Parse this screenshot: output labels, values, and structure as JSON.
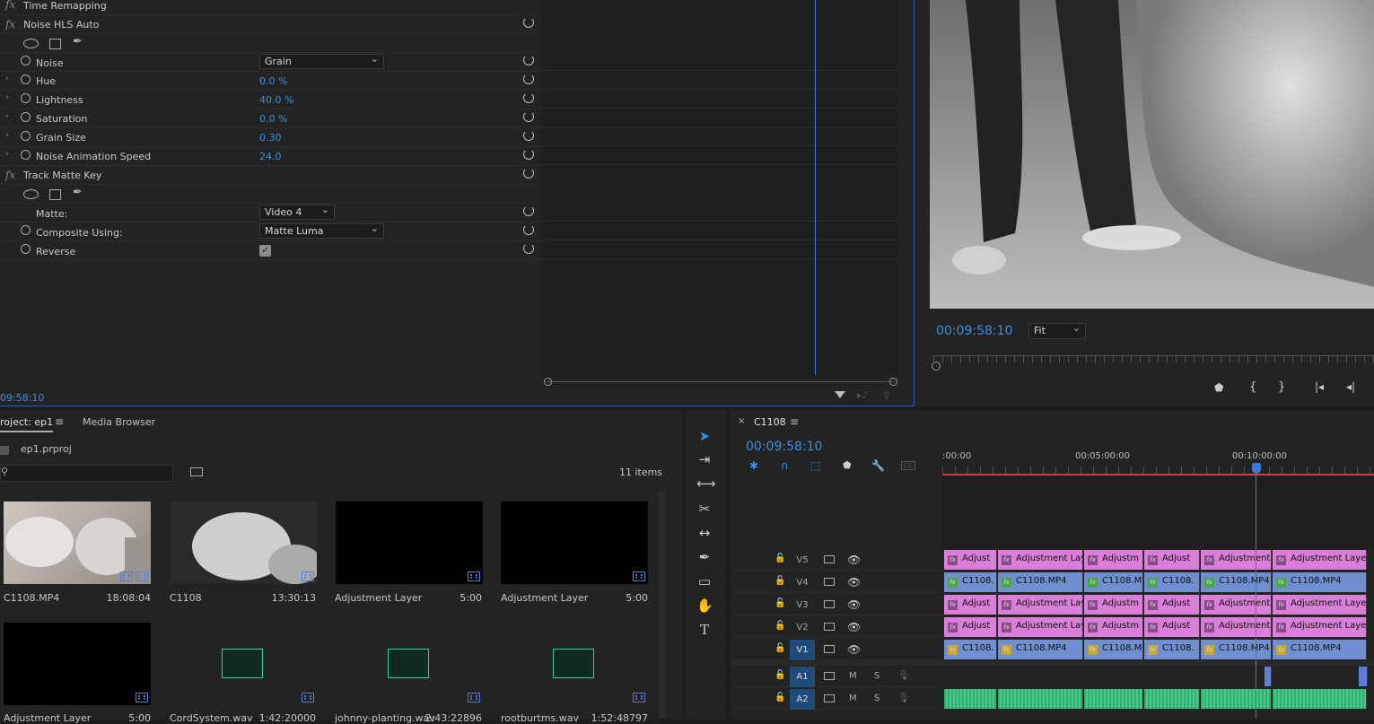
{
  "effect_controls": {
    "rows": [
      {
        "name": "Time Remapping",
        "type": "effect"
      },
      {
        "name": "Noise HLS Auto",
        "type": "effect"
      },
      {
        "type": "masks"
      },
      {
        "name": "Noise",
        "value": "Grain",
        "type": "dropdown"
      },
      {
        "name": "Hue",
        "value": "0.0 %",
        "type": "value"
      },
      {
        "name": "Lightness",
        "value": "40.0 %",
        "type": "value"
      },
      {
        "name": "Saturation",
        "value": "0.0 %",
        "type": "value"
      },
      {
        "name": "Grain Size",
        "value": "0.30",
        "type": "value"
      },
      {
        "name": "Noise Animation Speed",
        "value": "24.0",
        "type": "value"
      },
      {
        "name": "Track Matte Key",
        "type": "effect"
      },
      {
        "type": "masks"
      },
      {
        "name": "Matte:",
        "value": "Video 4",
        "type": "dropdown"
      },
      {
        "name": "Composite Using:",
        "value": "Matte Luma",
        "type": "dropdown"
      },
      {
        "name": "Reverse",
        "checked": true,
        "type": "checkbox"
      }
    ],
    "timecode": "09:58:10"
  },
  "program_monitor": {
    "timecode": "00:09:58:10",
    "fit": "Fit"
  },
  "project": {
    "tab_project": "roject: ep1",
    "tab_media": "Media Browser",
    "file": "ep1.prproj",
    "count": "11 items",
    "items": [
      {
        "name": "C1108.MP4",
        "dur": "18:08:04"
      },
      {
        "name": "C1108",
        "dur": "13:30:13"
      },
      {
        "name": "Adjustment Layer",
        "dur": "5:00"
      },
      {
        "name": "Adjustment Layer",
        "dur": "5:00"
      },
      {
        "name": "Adjustment Layer",
        "dur": "5:00"
      },
      {
        "name": "CordSystem.wav",
        "dur": "1:42:20000"
      },
      {
        "name": "johnny-planting.wav",
        "dur": "2:43:22896"
      },
      {
        "name": "rootburtms.wav",
        "dur": "1:52:48797"
      }
    ]
  },
  "timeline": {
    "seq": "C1108",
    "timecode": "00:09:58:10",
    "ruler": [
      ":00:00",
      "00:05:00:00",
      "00:10:00:00"
    ],
    "tracks": [
      "V5",
      "V4",
      "V3",
      "V2",
      "V1",
      "A1",
      "A2"
    ],
    "m_label": "M",
    "s_label": "S",
    "adj": [
      "Adjust",
      "Adjustment Lay",
      "Adjustm",
      "Adjust",
      "Adjustment",
      "Adjustment Layer"
    ],
    "vid": [
      "C1108.",
      "C1108.MP4",
      "C1108.M",
      "C1108.",
      "C1108.MP4",
      "C1108.MP4"
    ]
  }
}
